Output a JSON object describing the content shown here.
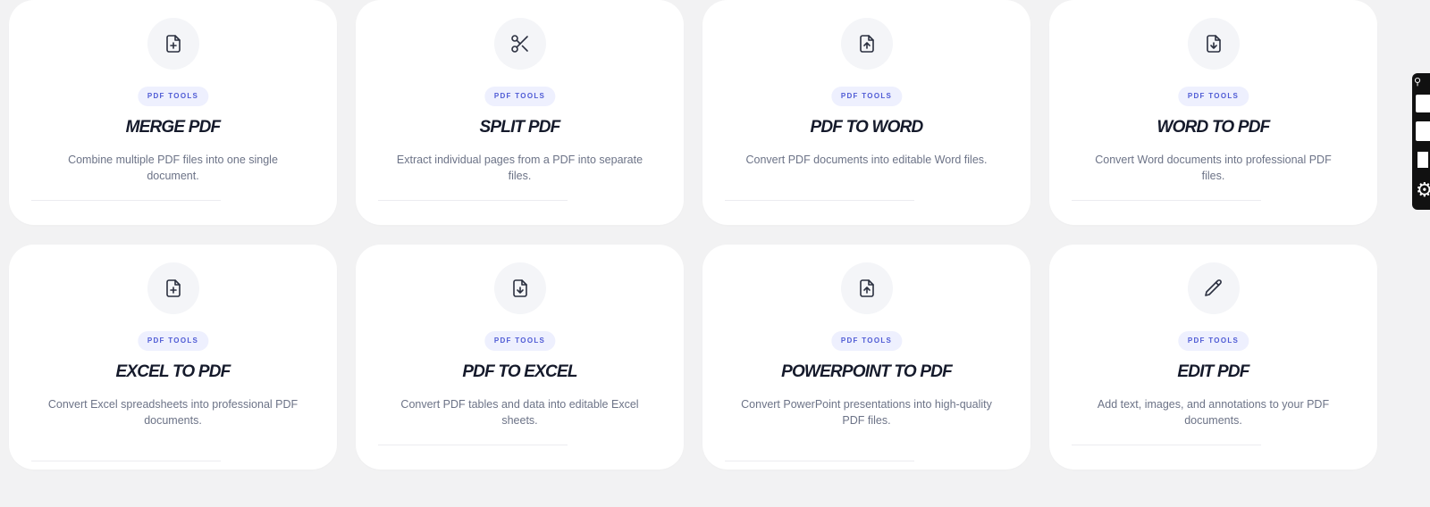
{
  "cards": [
    {
      "icon": "file-plus-icon",
      "tag": "PDF TOOLS",
      "title": "MERGE PDF",
      "description": "Combine multiple PDF files into one single document."
    },
    {
      "icon": "scissors-icon",
      "tag": "PDF TOOLS",
      "title": "SPLIT PDF",
      "description": "Extract individual pages from a PDF into separate files."
    },
    {
      "icon": "file-upload-icon",
      "tag": "PDF TOOLS",
      "title": "PDF TO WORD",
      "description": "Convert PDF documents into editable Word files."
    },
    {
      "icon": "file-download-icon",
      "tag": "PDF TOOLS",
      "title": "WORD TO PDF",
      "description": "Convert Word documents into professional PDF files."
    },
    {
      "icon": "file-plus-icon",
      "tag": "PDF TOOLS",
      "title": "EXCEL TO PDF",
      "description": "Convert Excel spreadsheets into professional PDF documents."
    },
    {
      "icon": "file-download-icon",
      "tag": "PDF TOOLS",
      "title": "PDF TO EXCEL",
      "description": "Convert PDF tables and data into editable Excel sheets."
    },
    {
      "icon": "file-upload-icon",
      "tag": "PDF TOOLS",
      "title": "POWERPOINT TO PDF",
      "description": "Convert PowerPoint presentations into high-quality PDF files."
    },
    {
      "icon": "pencil-icon",
      "tag": "PDF TOOLS",
      "title": "EDIT PDF",
      "description": "Add text, images, and annotations to your PDF documents."
    }
  ],
  "colors": {
    "background": "#f2f2f3",
    "card": "#ffffff",
    "tag_bg": "#eef0fe",
    "tag_text": "#4f5bd5",
    "title": "#151a2b",
    "description": "#6c7387"
  },
  "toolbar": {
    "icons": [
      "link-icon",
      "camera-icon",
      "rectangle-icon",
      "square-icon",
      "gear-icon"
    ]
  }
}
